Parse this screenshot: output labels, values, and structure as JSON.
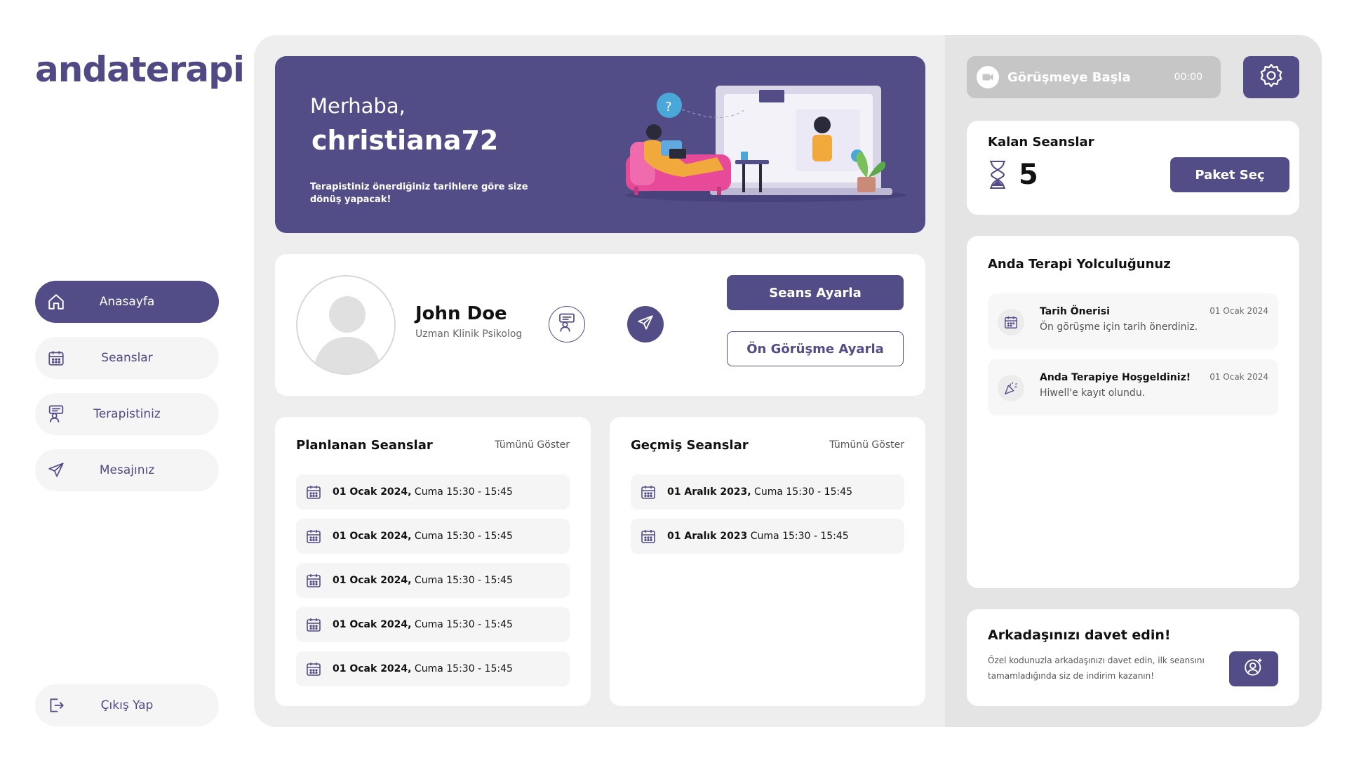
{
  "brand": {
    "logo_text": "andaterapi",
    "accent": "#524d87"
  },
  "sidebar": {
    "items": [
      {
        "label": "Anasayfa",
        "icon": "home-icon",
        "active": true
      },
      {
        "label": "Seanslar",
        "icon": "calendar-icon",
        "active": false
      },
      {
        "label": "Terapistiniz",
        "icon": "therapist-icon",
        "active": false
      },
      {
        "label": "Mesajınız",
        "icon": "send-icon",
        "active": false
      }
    ],
    "logout_label": "Çıkış Yap"
  },
  "hero": {
    "greeting": "Merhaba,",
    "username": "christiana72",
    "subtitle": "Terapistiniz önerdiğiniz tarihlere göre size dönüş yapacak!"
  },
  "therapist": {
    "name": "John Doe",
    "title": "Uzman Klinik Psikolog",
    "seans_button": "Seans Ayarla",
    "on_gorusme_button": "Ön Görüşme Ayarla"
  },
  "planned": {
    "heading": "Planlanan Seanslar",
    "show_all": "Tümünü Göster",
    "rows": [
      {
        "date": "01 Ocak 2024,",
        "time": " Cuma 15:30 - 15:45"
      },
      {
        "date": "01 Ocak 2024,",
        "time": " Cuma 15:30 - 15:45"
      },
      {
        "date": "01 Ocak 2024,",
        "time": " Cuma 15:30 - 15:45"
      },
      {
        "date": "01 Ocak 2024,",
        "time": " Cuma 15:30 - 15:45"
      },
      {
        "date": "01 Ocak 2024,",
        "time": " Cuma 15:30 - 15:45"
      }
    ]
  },
  "past": {
    "heading": "Geçmiş Seanslar",
    "show_all": "Tümünü Göster",
    "rows": [
      {
        "date": "01 Aralık 2023,",
        "time": " Cuma 15:30 - 15:45"
      },
      {
        "date": "01 Aralık 2023",
        "time": " Cuma 15:30 - 15:45"
      }
    ]
  },
  "call": {
    "label": "Görüşmeye Başla",
    "timer": "00:00"
  },
  "remaining": {
    "heading": "Kalan Seanslar",
    "count": "5",
    "button": "Paket Seç"
  },
  "journey": {
    "heading": "Anda Terapi Yolculuğunuz",
    "items": [
      {
        "title": "Tarih Önerisi",
        "desc": "Ön görüşme için tarih önerdiniz.",
        "date": "01 Ocak 2024",
        "icon": "calendar-icon"
      },
      {
        "title": "Anda Terapiye Hoşgeldiniz!",
        "desc": "Hiwell'e kayıt olundu.",
        "date": "01 Ocak 2024",
        "icon": "party-icon"
      }
    ]
  },
  "invite": {
    "heading": "Arkadaşınızı davet edin!",
    "desc": "Özel kodunuzla arkadaşınızı davet edin, ilk seansını tamamladığında siz de indirim kazanın!"
  }
}
